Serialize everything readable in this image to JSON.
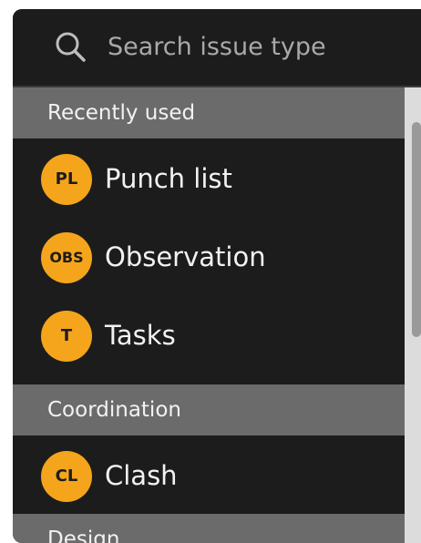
{
  "search": {
    "placeholder": "Search issue type",
    "value": ""
  },
  "sections": [
    {
      "title": "Recently used",
      "items": [
        {
          "abbr": "PL",
          "label": "Punch list"
        },
        {
          "abbr": "OBS",
          "label": "Observation"
        },
        {
          "abbr": "T",
          "label": "Tasks"
        }
      ]
    },
    {
      "title": "Coordination",
      "items": [
        {
          "abbr": "CL",
          "label": "Clash"
        }
      ]
    },
    {
      "title": "Design",
      "items": []
    }
  ],
  "colors": {
    "panel_background": "#1c1c1c",
    "section_header_background": "#6b6b6b",
    "badge": "#f5a51c"
  },
  "icons": {
    "search": "search-icon"
  }
}
